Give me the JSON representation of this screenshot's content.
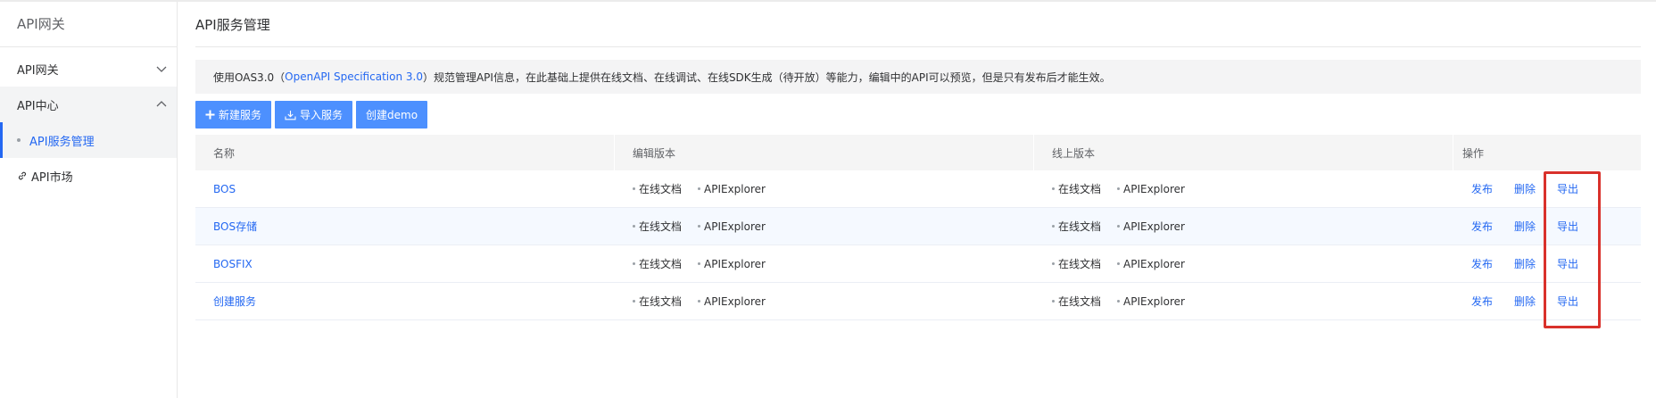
{
  "sidebar": {
    "title": "API网关",
    "groups": [
      {
        "label": "API网关",
        "expanded": false
      },
      {
        "label": "API中心",
        "expanded": true
      }
    ],
    "active_item": "API服务管理",
    "market": "API市场"
  },
  "header": {
    "title": "API服务管理"
  },
  "notice": {
    "prefix": "使用OAS3.0（",
    "link": "OpenAPI Specification 3.0",
    "suffix": "）规范管理API信息，在此基础上提供在线文档、在线调试、在线SDK生成（待开放）等能力，编辑中的API可以预览，但是只有发布后才能生效。"
  },
  "toolbar": {
    "new_service": "新建服务",
    "import_service": "导入服务",
    "create_demo": "创建demo"
  },
  "table": {
    "headers": {
      "name": "名称",
      "edit": "编辑版本",
      "online": "线上版本",
      "ops": "操作"
    },
    "doc_label": "在线文档",
    "explorer_label": "APIExplorer",
    "op_labels": {
      "publish": "发布",
      "delete": "删除",
      "export": "导出"
    },
    "rows": [
      {
        "name": "BOS"
      },
      {
        "name": "BOS存储"
      },
      {
        "name": "BOSFIX"
      },
      {
        "name": "创建服务"
      }
    ]
  },
  "colors": {
    "accent": "#2468f2",
    "button": "#4d90fe",
    "highlight": "#d9312b"
  }
}
